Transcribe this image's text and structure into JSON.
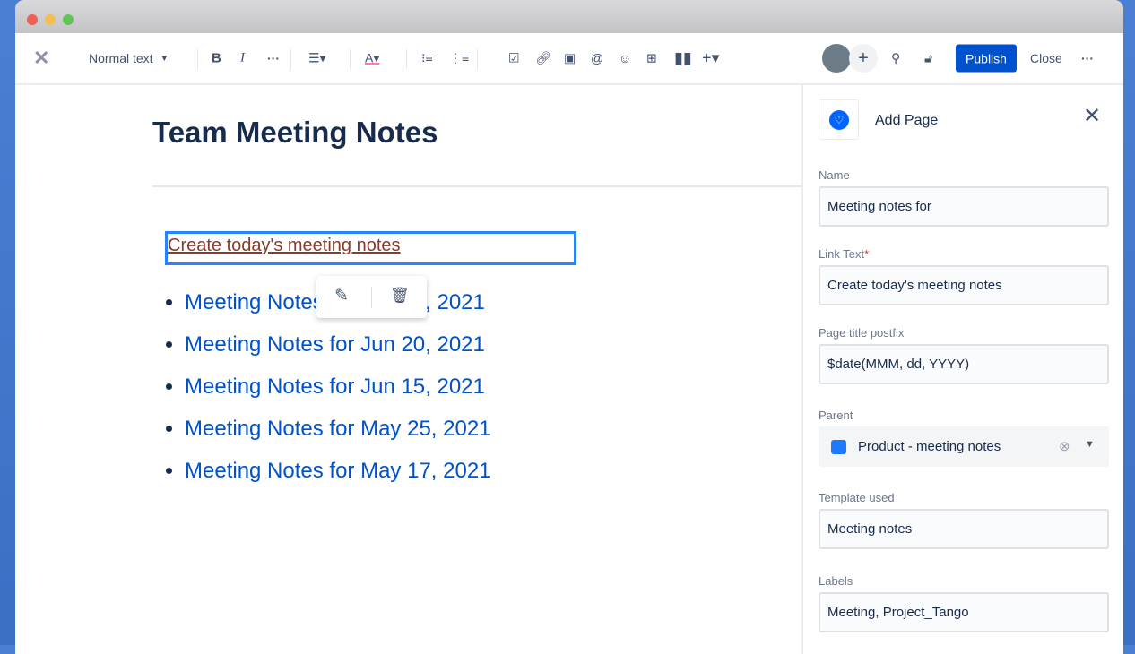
{
  "toolbar": {
    "text_style": "Normal text",
    "publish": "Publish",
    "close": "Close"
  },
  "page": {
    "title": "Team Meeting Notes",
    "link_text": "Create today's meeting notes",
    "items": [
      "Meeting Notes for Jun 24, 2021",
      "Meeting Notes for Jun 20, 2021",
      "Meeting Notes for Jun 15, 2021",
      "Meeting Notes for May 25, 2021",
      "Meeting Notes for May 17, 2021"
    ]
  },
  "panel": {
    "title": "Add Page",
    "name_label": "Name",
    "name_value": "Meeting notes for",
    "link_label": "Link Text",
    "required": "*",
    "link_value": "Create today's meeting notes",
    "postfix_label": "Page title postfix",
    "postfix_value": "$date(MMM, dd, YYYY)",
    "parent_label": "Parent",
    "parent_value": "Product - meeting notes",
    "template_label": "Template used",
    "template_value": "Meeting notes",
    "labels_label": "Labels",
    "labels_value": "Meeting, Project_Tango"
  },
  "colors": {
    "accent": "#0052cc",
    "selection": "#2684ff"
  }
}
